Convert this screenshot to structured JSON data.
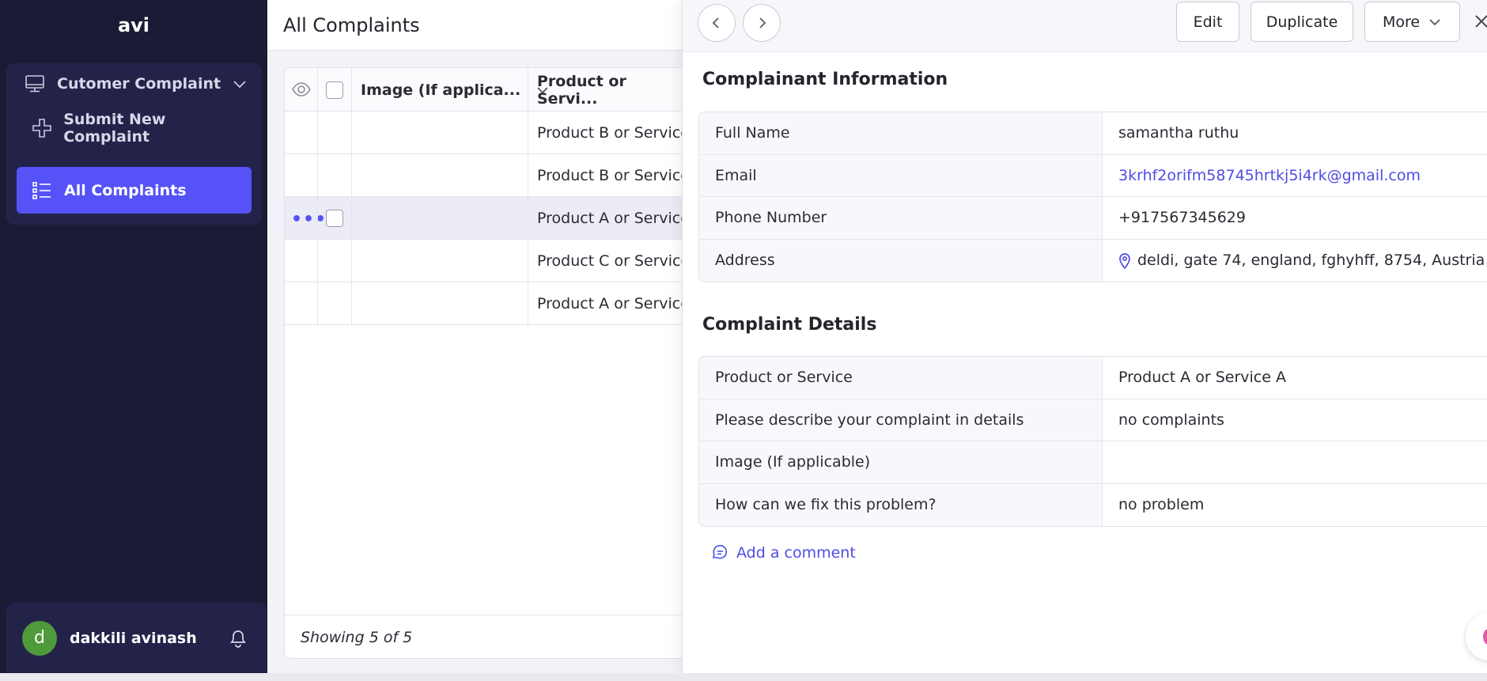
{
  "sidebar": {
    "app_title": "avi",
    "group_label": "Cutomer Complaint",
    "items": [
      {
        "label": "Submit New Complaint",
        "icon": "plus-icon"
      },
      {
        "label": "All Complaints",
        "icon": "list-icon",
        "active": true
      }
    ],
    "user": {
      "initial": "d",
      "name": "dakkili avinash"
    }
  },
  "main": {
    "title": "All Complaints",
    "columns": [
      "Image (If applica...",
      "Product or Servi..."
    ],
    "rows": [
      {
        "product": "Product B or Service"
      },
      {
        "product": "Product B or Service"
      },
      {
        "product": "Product A or Service",
        "selected": true
      },
      {
        "product": "Product C or Service"
      },
      {
        "product": "Product A or Service"
      }
    ],
    "footer": "Showing 5 of 5"
  },
  "panel": {
    "buttons": {
      "edit": "Edit",
      "duplicate": "Duplicate",
      "more": "More"
    },
    "complainant_title": "Complainant Information",
    "complainant": [
      {
        "label": "Full Name",
        "value": "samantha ruthu"
      },
      {
        "label": "Email",
        "value": "3krhf2orifm58745hrtkj5i4rk@gmail.com"
      },
      {
        "label": "Phone Number",
        "value": "+917567345629"
      },
      {
        "label": "Address",
        "value": "deldi, gate 74, england, fghyhff, 8754, Austria"
      }
    ],
    "details_title": "Complaint Details",
    "details": [
      {
        "label": "Product or Service",
        "value": "Product A or Service A"
      },
      {
        "label": "Please describe your complaint in details",
        "value": "no complaints"
      },
      {
        "label": "Image (If applicable)",
        "value": ""
      },
      {
        "label": "How can we fix this problem?",
        "value": "no problem"
      }
    ],
    "add_comment": "Add a comment"
  },
  "colors": {
    "accent": "#5552f7",
    "sidebar_bg": "#1b1b36",
    "link": "#4f4ce6"
  }
}
